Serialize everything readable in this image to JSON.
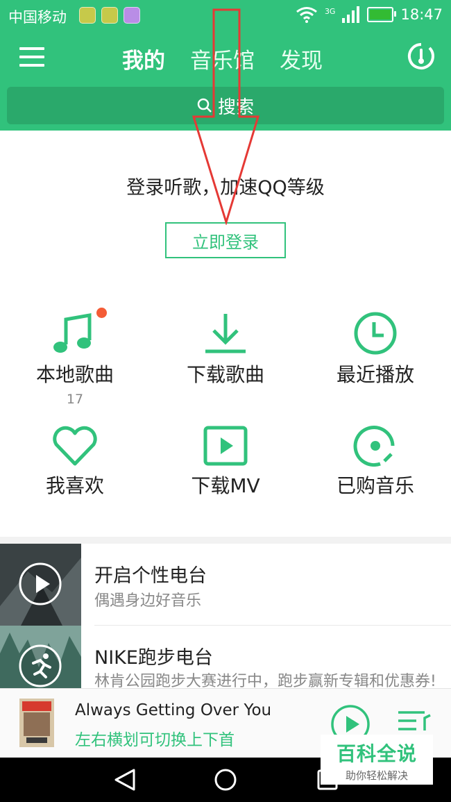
{
  "status_bar": {
    "carrier": "中国移动",
    "network": "3G",
    "time": "18:47"
  },
  "top_nav": {
    "tabs": [
      {
        "label": "我的",
        "active": true
      },
      {
        "label": "音乐馆",
        "active": false
      },
      {
        "label": "发现",
        "active": false
      }
    ]
  },
  "search": {
    "label": "搜索",
    "icon": "search-icon"
  },
  "login": {
    "prompt": "登录听歌，加速QQ等级",
    "button_label": "立即登录"
  },
  "quick_items": [
    {
      "label": "本地歌曲",
      "icon": "music-note-icon",
      "count": "17"
    },
    {
      "label": "下载歌曲",
      "icon": "download-icon"
    },
    {
      "label": "最近播放",
      "icon": "clock-icon"
    },
    {
      "label": "我喜欢",
      "icon": "heart-icon"
    },
    {
      "label": "下载MV",
      "icon": "video-play-icon"
    },
    {
      "label": "已购音乐",
      "icon": "purchased-disc-icon"
    }
  ],
  "radios": [
    {
      "title": "开启个性电台",
      "subtitle": "偶遇身边好音乐",
      "icon": "play-icon"
    },
    {
      "title": "NIKE跑步电台",
      "subtitle": "林肯公园跑步大赛进行中，跑步赢新专辑和优惠券!",
      "icon": "runner-icon"
    }
  ],
  "player": {
    "song_title": "Always Getting Over You",
    "hint": "左右横划可切换上下首"
  },
  "watermark": {
    "title": "百科全说",
    "subtitle": "助你轻松解决"
  },
  "colors": {
    "brand_green": "#31c27c",
    "badge_red": "#f45c36",
    "annotation_red": "#e53935"
  }
}
